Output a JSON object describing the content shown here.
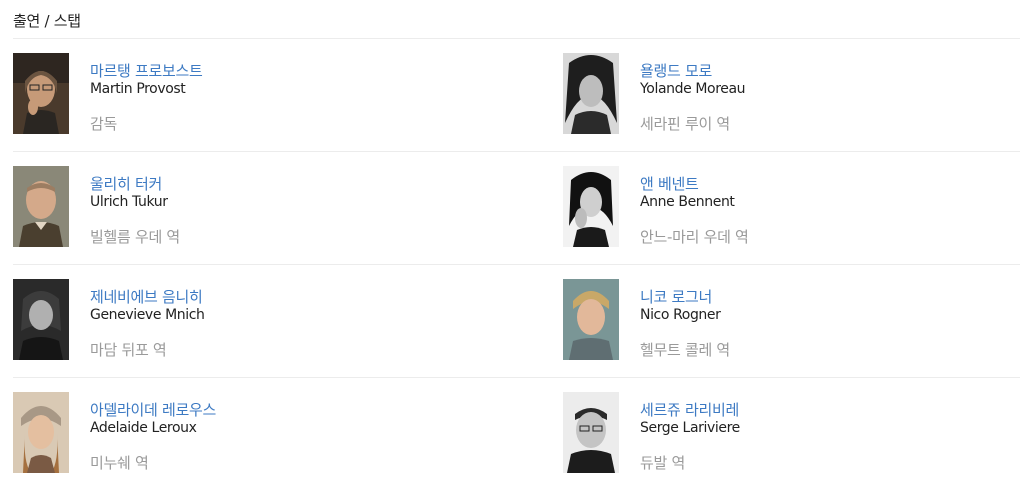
{
  "section": {
    "title": "출연 / 스탭"
  },
  "cast": [
    {
      "name_ko": "마르탱 프로보스트",
      "name_en": "Martin Provost",
      "role": "감독"
    },
    {
      "name_ko": "욜랭드 모로",
      "name_en": "Yolande Moreau",
      "role": "세라핀 루이 역"
    },
    {
      "name_ko": "울리히 터커",
      "name_en": "Ulrich Tukur",
      "role": "빌헬름 우데 역"
    },
    {
      "name_ko": "앤 베넨트",
      "name_en": "Anne Bennent",
      "role": "안느-마리 우데 역"
    },
    {
      "name_ko": "제네비에브 음니히",
      "name_en": "Genevieve Mnich",
      "role": "마담 뒤포 역"
    },
    {
      "name_ko": "니코 로그너",
      "name_en": "Nico Rogner",
      "role": "헬무트 콜레 역"
    },
    {
      "name_ko": "아델라이데 레로우스",
      "name_en": "Adelaide Leroux",
      "role": "미누쉐 역"
    },
    {
      "name_ko": "세르쥬 라리비레",
      "name_en": "Serge Lariviere",
      "role": "듀발 역"
    }
  ]
}
